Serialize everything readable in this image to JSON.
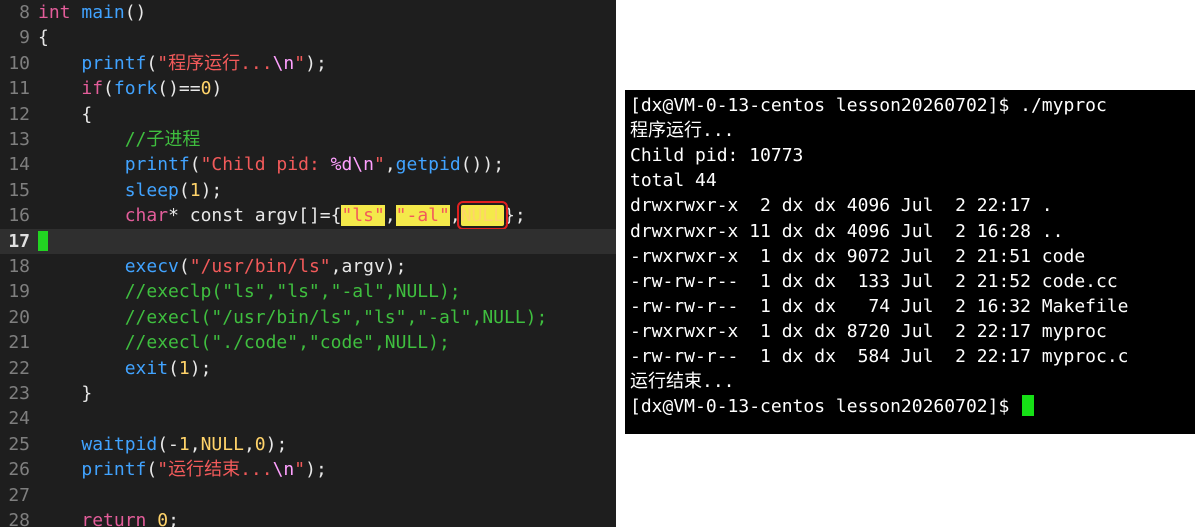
{
  "editor": {
    "lines": [
      {
        "n": "8",
        "tokens": [
          {
            "t": "int",
            "c": "kw"
          },
          {
            "t": " "
          },
          {
            "t": "main",
            "c": "fn"
          },
          {
            "t": "()"
          }
        ]
      },
      {
        "n": "9",
        "tokens": [
          {
            "t": "{"
          }
        ]
      },
      {
        "n": "10",
        "tokens": [
          {
            "t": "    "
          },
          {
            "t": "printf",
            "c": "fn"
          },
          {
            "t": "("
          },
          {
            "t": "\"程序运行...",
            "c": "str"
          },
          {
            "t": "\\n",
            "c": "esc"
          },
          {
            "t": "\"",
            "c": "str"
          },
          {
            "t": ");"
          }
        ]
      },
      {
        "n": "11",
        "tokens": [
          {
            "t": "    "
          },
          {
            "t": "if",
            "c": "kw"
          },
          {
            "t": "("
          },
          {
            "t": "fork",
            "c": "fn"
          },
          {
            "t": "()=="
          },
          {
            "t": "0",
            "c": "num"
          },
          {
            "t": ")"
          }
        ]
      },
      {
        "n": "12",
        "tokens": [
          {
            "t": "    {"
          }
        ]
      },
      {
        "n": "13",
        "tokens": [
          {
            "t": "        "
          },
          {
            "t": "//子进程",
            "c": "cmt"
          }
        ]
      },
      {
        "n": "14",
        "tokens": [
          {
            "t": "        "
          },
          {
            "t": "printf",
            "c": "fn"
          },
          {
            "t": "("
          },
          {
            "t": "\"Child pid: ",
            "c": "str"
          },
          {
            "t": "%d\\n",
            "c": "esc"
          },
          {
            "t": "\"",
            "c": "str"
          },
          {
            "t": ","
          },
          {
            "t": "getpid",
            "c": "fn"
          },
          {
            "t": "());"
          }
        ]
      },
      {
        "n": "15",
        "tokens": [
          {
            "t": "        "
          },
          {
            "t": "sleep",
            "c": "fn"
          },
          {
            "t": "("
          },
          {
            "t": "1",
            "c": "num"
          },
          {
            "t": ");"
          }
        ]
      },
      {
        "n": "16",
        "tokens": [
          {
            "t": "        "
          },
          {
            "t": "char",
            "c": "kw"
          },
          {
            "t": "* const argv[]={"
          },
          {
            "t": "\"ls\"",
            "c": "str hl"
          },
          {
            "t": ","
          },
          {
            "t": "\"-al\"",
            "c": "str hl"
          },
          {
            "t": ","
          },
          {
            "t": "NULL",
            "c": "num hl-red"
          },
          {
            "t": "};"
          }
        ]
      },
      {
        "n": "17",
        "current": true,
        "cursor": true,
        "tokens": []
      },
      {
        "n": "18",
        "tokens": [
          {
            "t": "        "
          },
          {
            "t": "execv",
            "c": "fn"
          },
          {
            "t": "("
          },
          {
            "t": "\"/usr/bin/ls\"",
            "c": "str"
          },
          {
            "t": ",argv);"
          }
        ]
      },
      {
        "n": "19",
        "tokens": [
          {
            "t": "        "
          },
          {
            "t": "//execlp(\"ls\",\"ls\",\"-al\",NULL);",
            "c": "cmt"
          }
        ]
      },
      {
        "n": "20",
        "tokens": [
          {
            "t": "        "
          },
          {
            "t": "//execl(\"/usr/bin/ls\",\"ls\",\"-al\",NULL);",
            "c": "cmt"
          }
        ]
      },
      {
        "n": "21",
        "tokens": [
          {
            "t": "        "
          },
          {
            "t": "//execl(\"./code\",\"code\",NULL);",
            "c": "cmt"
          }
        ]
      },
      {
        "n": "22",
        "tokens": [
          {
            "t": "        "
          },
          {
            "t": "exit",
            "c": "fn"
          },
          {
            "t": "("
          },
          {
            "t": "1",
            "c": "num"
          },
          {
            "t": ");"
          }
        ]
      },
      {
        "n": "23",
        "tokens": [
          {
            "t": "    }"
          }
        ]
      },
      {
        "n": "24",
        "tokens": []
      },
      {
        "n": "25",
        "tokens": [
          {
            "t": "    "
          },
          {
            "t": "waitpid",
            "c": "fn"
          },
          {
            "t": "(-"
          },
          {
            "t": "1",
            "c": "num"
          },
          {
            "t": ","
          },
          {
            "t": "NULL",
            "c": "num"
          },
          {
            "t": ","
          },
          {
            "t": "0",
            "c": "num"
          },
          {
            "t": ");"
          }
        ]
      },
      {
        "n": "26",
        "tokens": [
          {
            "t": "    "
          },
          {
            "t": "printf",
            "c": "fn"
          },
          {
            "t": "("
          },
          {
            "t": "\"运行结束...",
            "c": "str"
          },
          {
            "t": "\\n",
            "c": "esc"
          },
          {
            "t": "\"",
            "c": "str"
          },
          {
            "t": ");"
          }
        ]
      },
      {
        "n": "27",
        "tokens": []
      },
      {
        "n": "28",
        "tokens": [
          {
            "t": "    "
          },
          {
            "t": "return",
            "c": "kw"
          },
          {
            "t": " "
          },
          {
            "t": "0",
            "c": "num"
          },
          {
            "t": ";"
          }
        ]
      }
    ]
  },
  "terminal": {
    "lines": [
      "[dx@VM-0-13-centos lesson20260702]$ ./myproc",
      "程序运行...",
      "Child pid: 10773",
      "total 44",
      "drwxrwxr-x  2 dx dx 4096 Jul  2 22:17 .",
      "drwxrwxr-x 11 dx dx 4096 Jul  2 16:28 ..",
      "-rwxrwxr-x  1 dx dx 9072 Jul  2 21:51 code",
      "-rw-rw-r--  1 dx dx  133 Jul  2 21:52 code.cc",
      "-rw-rw-r--  1 dx dx   74 Jul  2 16:32 Makefile",
      "-rwxrwxr-x  1 dx dx 8720 Jul  2 22:17 myproc",
      "-rw-rw-r--  1 dx dx  584 Jul  2 22:17 myproc.c",
      "运行结束...",
      "[dx@VM-0-13-centos lesson20260702]$ "
    ],
    "cursor_line": 12
  },
  "colors": {
    "editor_bg": "#1e1e1e",
    "terminal_bg": "#000000",
    "cursor": "#16e016",
    "highlight": "#f4e94a",
    "box": "#e02020"
  }
}
